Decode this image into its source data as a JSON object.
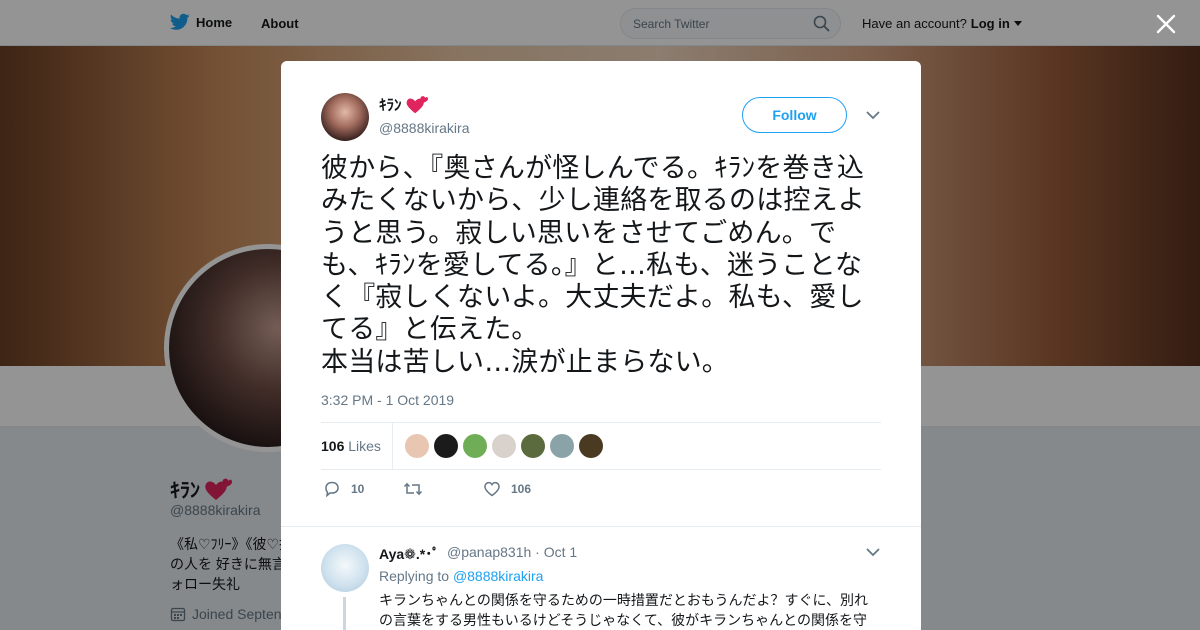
{
  "nav": {
    "home_label": "Home",
    "about_label": "About",
    "search_placeholder": "Search Twitter",
    "account_prompt": "Have an account?",
    "login_label": "Log in"
  },
  "profile": {
    "name": "ｷﾗﾝ",
    "handle": "@8888kirakira",
    "bio": "《私♡ﾌﾘｰ》《彼♡持ちの人を 好きに無言フォロー失礼",
    "joined": "Joined Septen"
  },
  "tweet": {
    "author_name": "ｷﾗﾝ",
    "author_handle": "@8888kirakira",
    "follow_label": "Follow",
    "text": "彼から、『奥さんが怪しんでる。ｷﾗﾝを巻き込みたくないから、少し連絡を取るのは控えようと思う。寂しい思いをさせてごめん。でも、ｷﾗﾝを愛してる。』と…私も、迷うことなく『寂しくないよ。大丈夫だよ。私も、愛してる』と伝えた。\n本当は苦しい…涙が止まらない。",
    "timestamp": "3:32 PM - 1 Oct 2019",
    "likes_count": "106",
    "likes_label": "Likes",
    "reply_count": "10",
    "retweet_count": "",
    "like_count": "106"
  },
  "likers": [
    {
      "icon": "liker-avatar",
      "color": "#e8c6b2"
    },
    {
      "icon": "liker-avatar",
      "color": "#1b1b1b"
    },
    {
      "icon": "liker-avatar",
      "color": "#6fae57"
    },
    {
      "icon": "liker-avatar",
      "color": "#d9d2cc"
    },
    {
      "icon": "liker-avatar",
      "color": "#5b6b3e"
    },
    {
      "icon": "liker-avatar",
      "color": "#8aa3a8"
    },
    {
      "icon": "liker-avatar",
      "color": "#4a3a22"
    }
  ],
  "reply": {
    "author_name": "Aya❁.*･ﾟ",
    "author_handle": "@panap831h · Oct 1",
    "replying_prefix": "Replying to",
    "replying_to": "@8888kirakira",
    "text": "キランちゃんとの関係を守るための一時措置だとおもうんだよ？すぐに、別れの言葉をする男性もいるけどそうじゃなくて、彼がキランちゃんとの関係を守"
  },
  "colors": {
    "brand": "#1da1f2",
    "heart": "#e0245e"
  }
}
